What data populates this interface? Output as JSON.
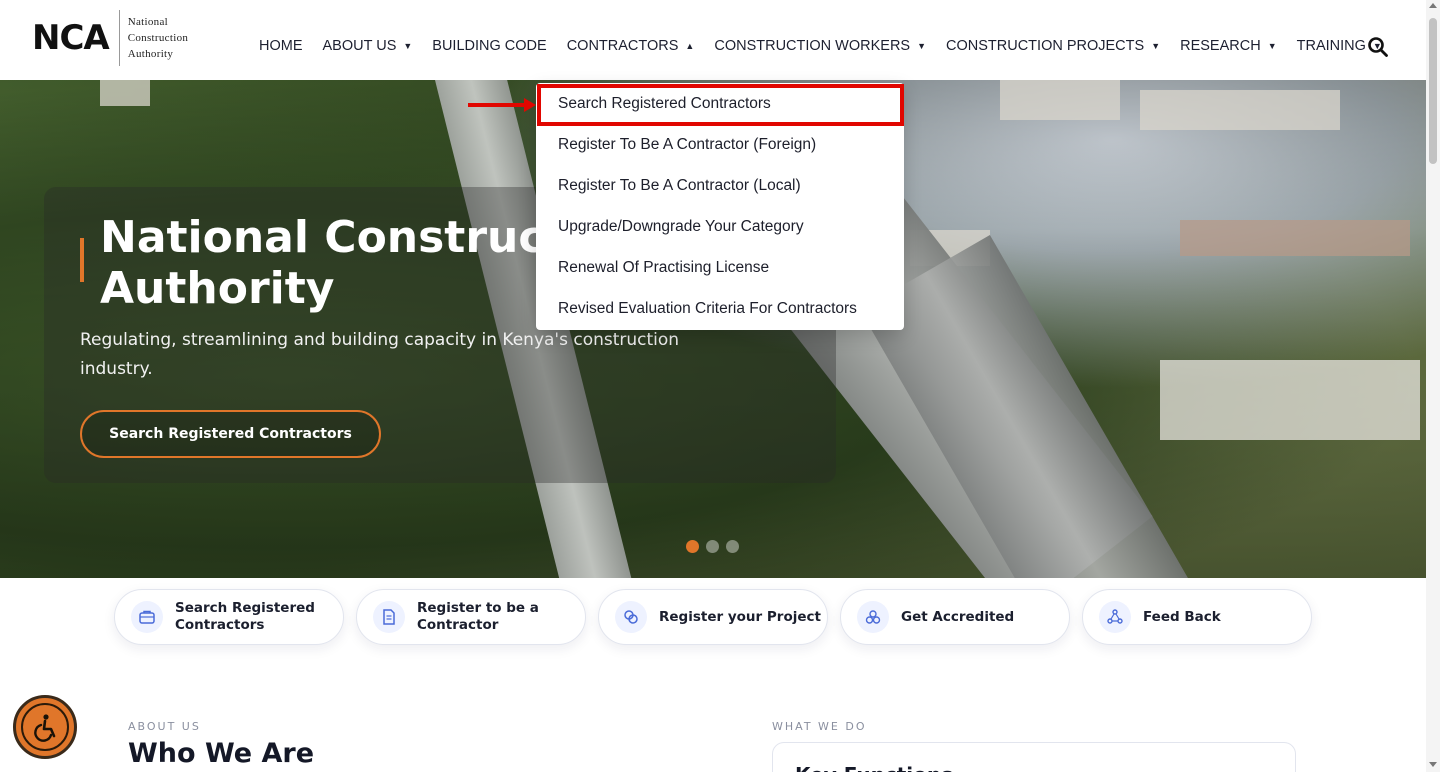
{
  "logo": {
    "mark": "NCA",
    "line1": "National",
    "line2": "Construction",
    "line3": "Authority"
  },
  "nav": {
    "items": [
      {
        "label": "HOME",
        "has_chevron": false
      },
      {
        "label": "ABOUT US",
        "has_chevron": true
      },
      {
        "label": "BUILDING CODE",
        "has_chevron": false
      },
      {
        "label": "CONTRACTORS",
        "has_chevron": true,
        "expanded": true
      },
      {
        "label": "CONSTRUCTION WORKERS",
        "has_chevron": true
      },
      {
        "label": "CONSTRUCTION PROJECTS",
        "has_chevron": true
      },
      {
        "label": "RESEARCH",
        "has_chevron": true
      },
      {
        "label": "TRAINING",
        "has_chevron": true
      }
    ],
    "search_icon": "search-icon"
  },
  "dropdown": {
    "items": [
      "Search Registered Contractors",
      "Register To Be A Contractor (Foreign)",
      "Register To Be A Contractor (Local)",
      "Upgrade/Downgrade Your Category",
      "Renewal Of Practising License",
      "Revised Evaluation Criteria For Contractors"
    ],
    "highlighted_index": 0
  },
  "hero": {
    "title": "National Construct\nAuthority",
    "subtitle": "Regulating, streamlining and building capacity in Kenya's construction industry.",
    "cta": "Search Registered Contractors",
    "slides": 3,
    "active_slide": 0
  },
  "quick_links": [
    {
      "label": "Search Registered Contractors",
      "icon": "briefcase-icon"
    },
    {
      "label": "Register to be a Contractor",
      "icon": "document-icon"
    },
    {
      "label": "Register your Project",
      "icon": "rings-icon"
    },
    {
      "label": "Get Accredited",
      "icon": "badge-icon"
    },
    {
      "label": "Feed Back",
      "icon": "feedback-icon"
    }
  ],
  "about": {
    "label": "ABOUT US",
    "title": "Who We Are"
  },
  "what_we_do": {
    "label": "WHAT WE DO",
    "card_title": "Key Functions"
  },
  "colors": {
    "accent": "#e0762a",
    "annotation": "#e10600",
    "text": "#1d2030"
  },
  "accessibility_icon": "wheelchair-icon"
}
